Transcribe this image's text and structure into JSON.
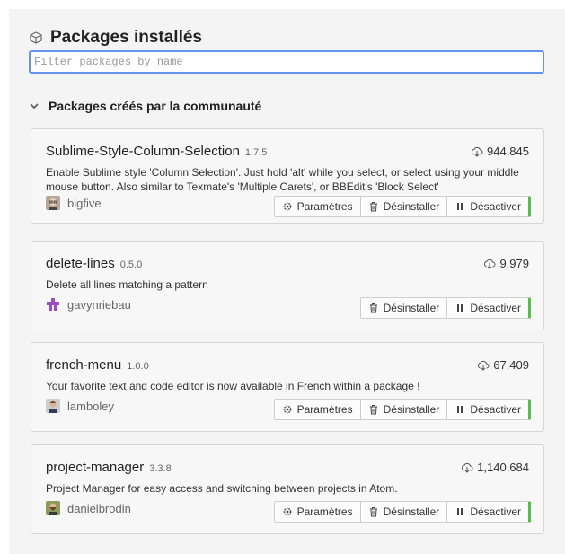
{
  "page": {
    "title": "Packages installés",
    "filter_placeholder": "Filter packages by name",
    "section_label": "Packages créés par la communauté"
  },
  "colors": {
    "accent": "#6494ed",
    "enabled_indicator": "#50c24a"
  },
  "buttons": {
    "settings": "Paramètres",
    "uninstall": "Désinstaller",
    "disable": "Désactiver"
  },
  "packages": [
    {
      "name": "Sublime-Style-Column-Selection",
      "version": "1.7.5",
      "downloads": "944,845",
      "description": "Enable Sublime style 'Column Selection'. Just hold 'alt' while you select, or select using your middle mouse button. Also similar to Texmate's 'Multiple Carets', or BBEdit's 'Block Select'",
      "author": "bigfive",
      "avatar_icon": "man-with-glasses-avatar",
      "has_settings": true
    },
    {
      "name": "delete-lines",
      "version": "0.5.0",
      "downloads": "9,979",
      "description": "Delete all lines matching a pattern",
      "author": "gavynriebau",
      "avatar_icon": "purple-identicon-avatar",
      "has_settings": false
    },
    {
      "name": "french-menu",
      "version": "1.0.0",
      "downloads": "67,409",
      "description": "Your favorite text and code editor is now available in French within a package !",
      "author": "lamboley",
      "avatar_icon": "person-avatar",
      "has_settings": true
    },
    {
      "name": "project-manager",
      "version": "3.3.8",
      "downloads": "1,140,684",
      "description": "Project Manager for easy access and switching between projects in Atom.",
      "author": "danielbrodin",
      "avatar_icon": "bearded-man-avatar",
      "has_settings": true
    }
  ]
}
